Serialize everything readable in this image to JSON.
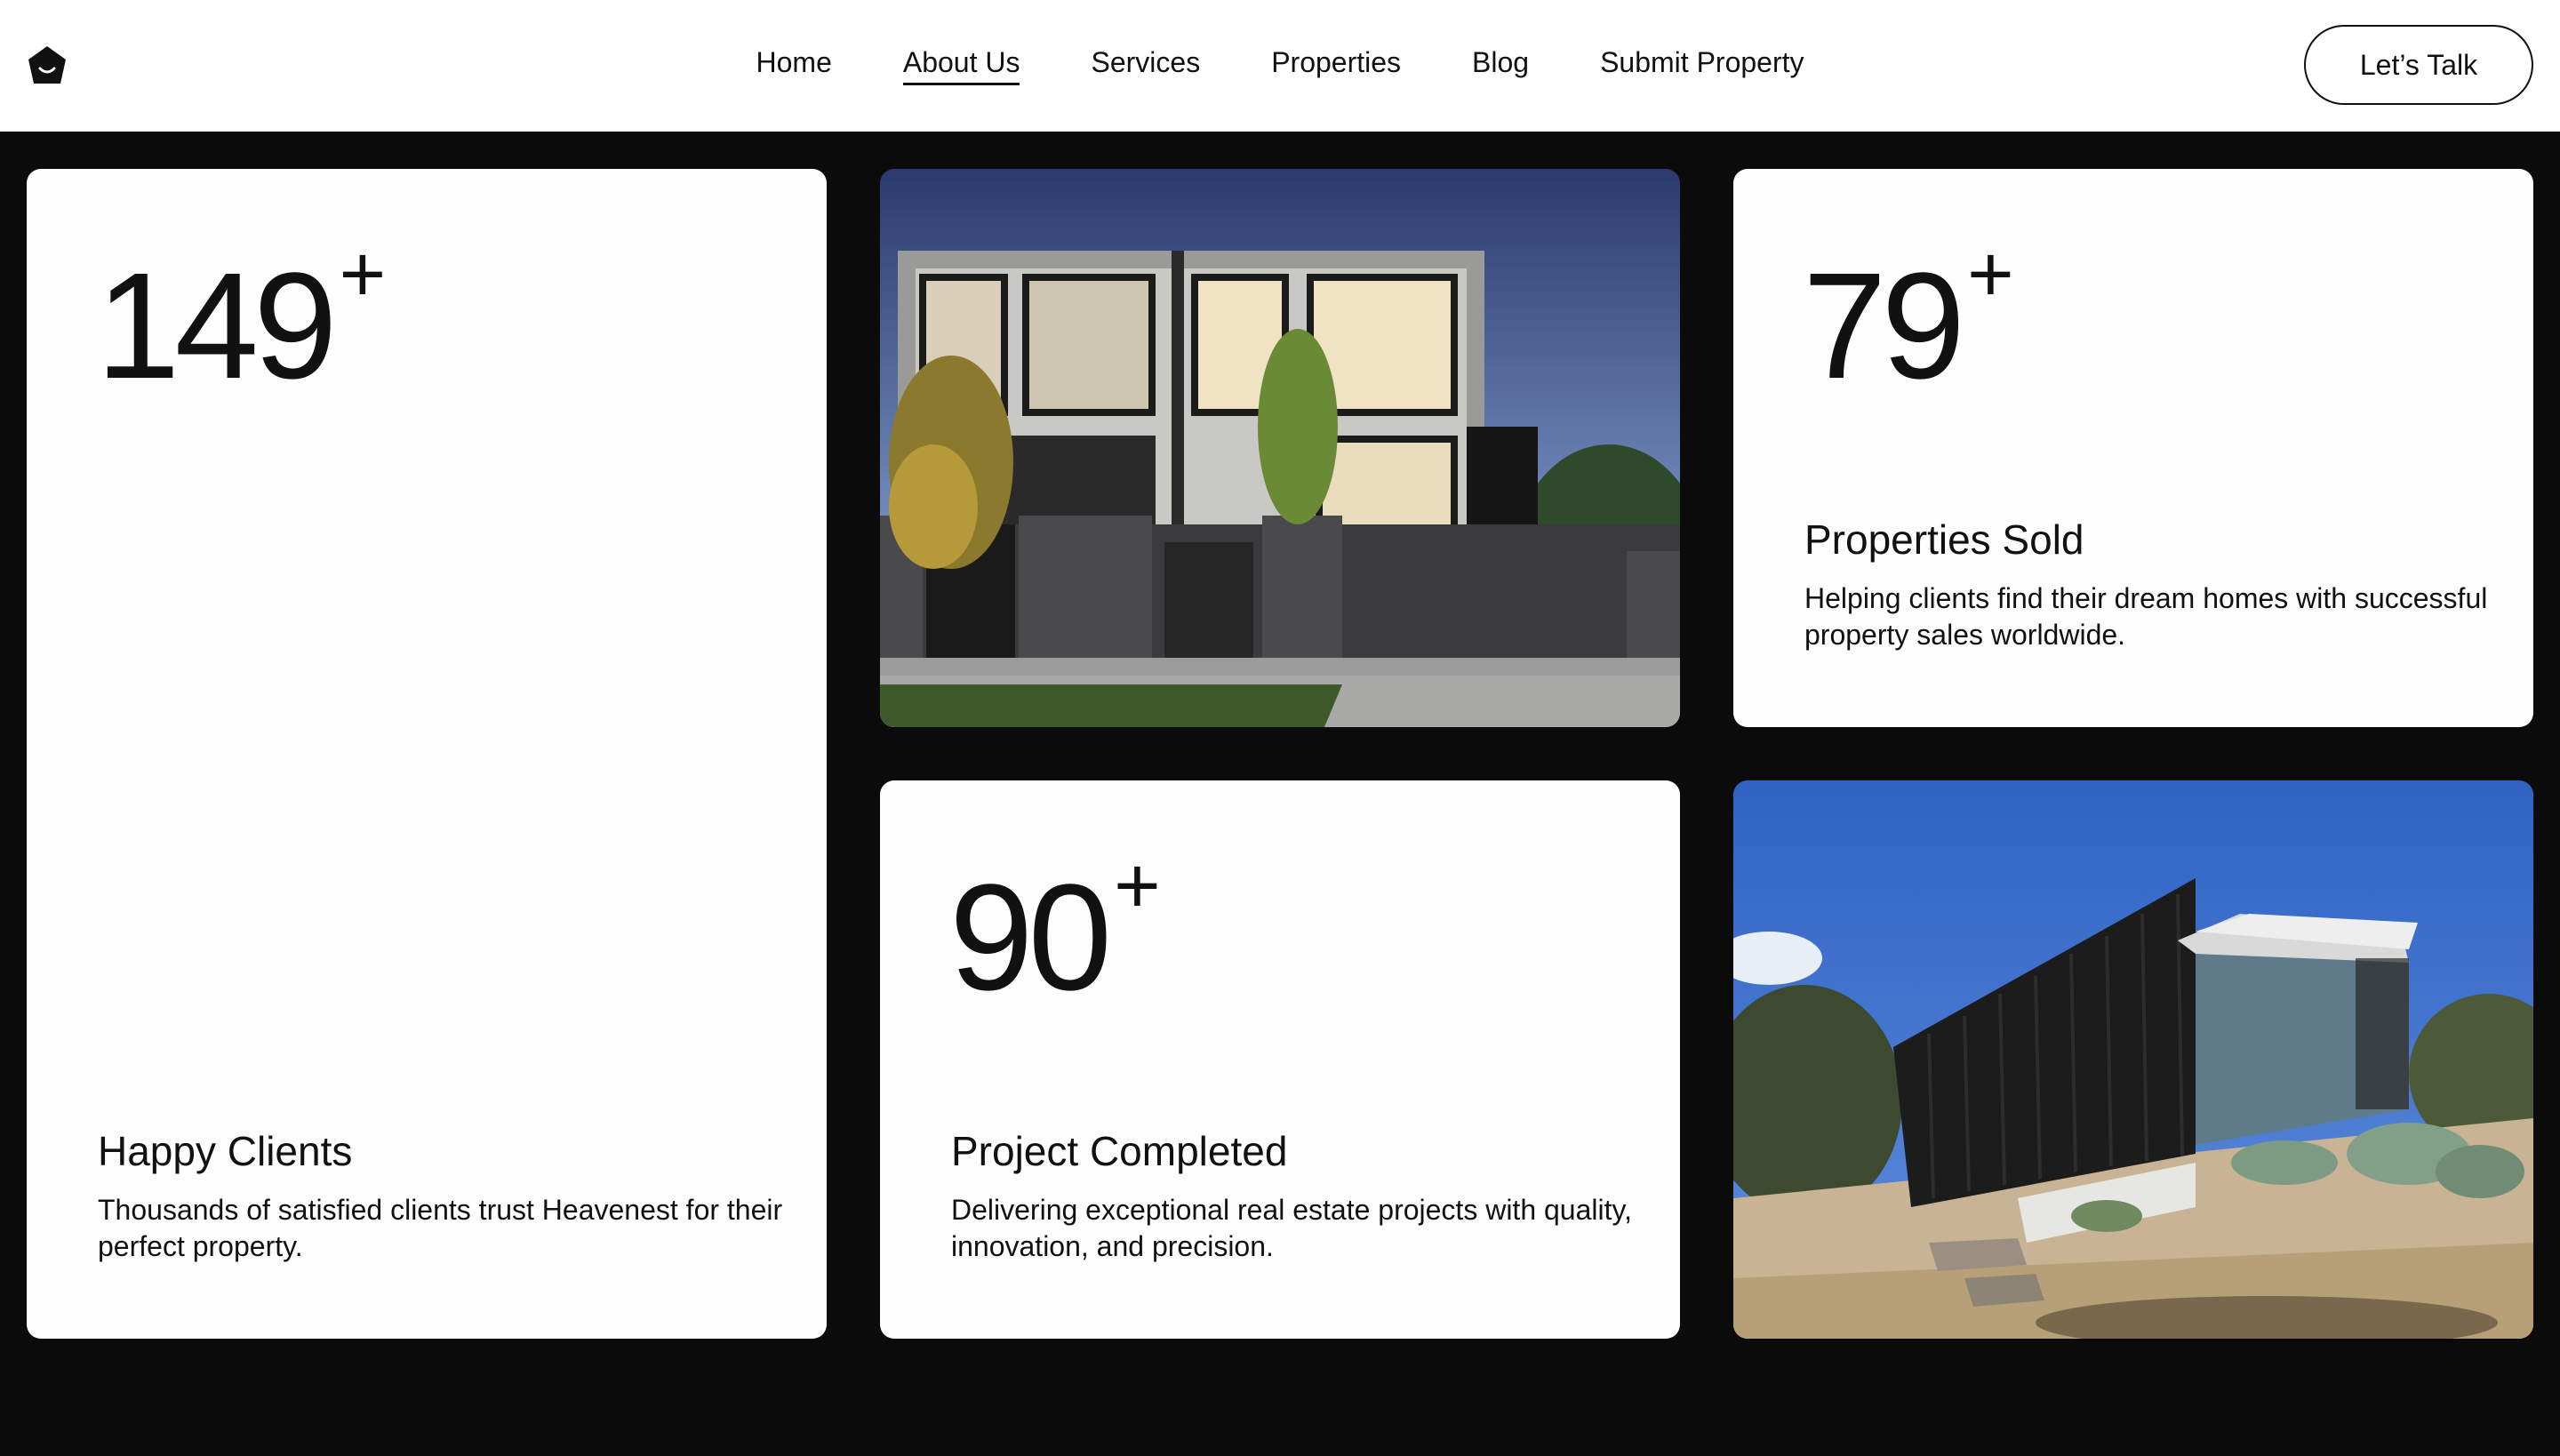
{
  "nav": {
    "items": [
      {
        "label": "Home"
      },
      {
        "label": "About Us"
      },
      {
        "label": "Services"
      },
      {
        "label": "Properties"
      },
      {
        "label": "Blog"
      },
      {
        "label": "Submit Property"
      }
    ],
    "active": "About Us",
    "cta_label": "Let’s Talk"
  },
  "stats": {
    "happy_clients": {
      "number": "149",
      "suffix": "+",
      "title": "Happy Clients",
      "description": "Thousands of satisfied clients trust Heavenest for their perfect property."
    },
    "properties_sold": {
      "number": "79",
      "suffix": "+",
      "title": "Properties Sold",
      "description": "Helping clients find their dream homes with successful property sales worldwide."
    },
    "projects_completed": {
      "number": "90",
      "suffix": "+",
      "title": "Project Completed",
      "description": "Delivering exceptional real estate projects with quality, innovation, and precision."
    }
  },
  "colors": {
    "page_background": "#0b0b0b",
    "card_background": "#fdfdfd",
    "text": "#111111"
  }
}
